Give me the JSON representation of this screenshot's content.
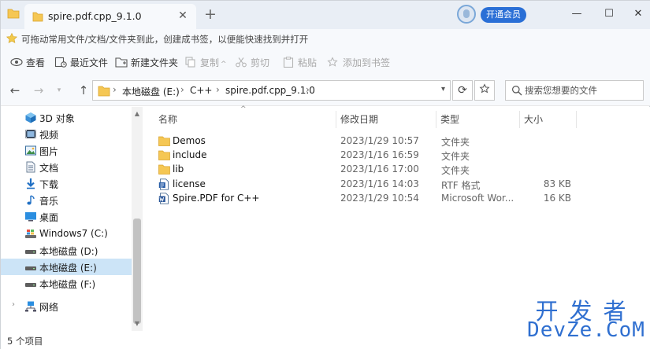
{
  "tab": {
    "title": "spire.pdf.cpp_9.1.0",
    "close": "✕",
    "new_tab": "+"
  },
  "header": {
    "vip_label": "开通会员",
    "minimize": "—",
    "maximize": "☐",
    "close": "✕"
  },
  "bookmark_bar": {
    "text": "可拖动常用文件/文档/文件夹到此，创建成书签，以便能快速找到并打开"
  },
  "toolbar": {
    "view": "查看",
    "recent": "最近文件",
    "new_folder": "新建文件夹",
    "copy": "复制",
    "cut": "剪切",
    "paste": "粘贴",
    "add_bookmark": "添加到书签"
  },
  "nav": {
    "back": "←",
    "forward": "→",
    "up": "↑",
    "breadcrumb": [
      "本地磁盘 (E:)",
      "C++",
      "spire.pdf.cpp_9.1.0"
    ],
    "separator": "›",
    "refresh": "⟳",
    "search_placeholder": "搜索您想要的文件"
  },
  "sidebar": {
    "items": [
      {
        "label": "3D 对象",
        "icon": "3d-objects-icon"
      },
      {
        "label": "视频",
        "icon": "video-icon"
      },
      {
        "label": "图片",
        "icon": "pictures-icon"
      },
      {
        "label": "文档",
        "icon": "documents-icon"
      },
      {
        "label": "下载",
        "icon": "downloads-icon"
      },
      {
        "label": "音乐",
        "icon": "music-icon"
      },
      {
        "label": "桌面",
        "icon": "desktop-icon"
      },
      {
        "label": "Windows7 (C:)",
        "icon": "drive-icon"
      },
      {
        "label": "本地磁盘 (D:)",
        "icon": "drive-icon"
      },
      {
        "label": "本地磁盘 (E:)",
        "icon": "drive-icon",
        "selected": true
      },
      {
        "label": "本地磁盘 (F:)",
        "icon": "drive-icon"
      },
      {
        "label": "网络",
        "icon": "network-icon"
      }
    ]
  },
  "columns": {
    "name": "名称",
    "modified": "修改日期",
    "type": "类型",
    "size": "大小"
  },
  "files": [
    {
      "name": "Demos",
      "modified": "2023/1/29 10:57",
      "type": "文件夹",
      "size": "",
      "icon": "folder-icon"
    },
    {
      "name": "include",
      "modified": "2023/1/16 16:59",
      "type": "文件夹",
      "size": "",
      "icon": "folder-icon"
    },
    {
      "name": "lib",
      "modified": "2023/1/16 17:00",
      "type": "文件夹",
      "size": "",
      "icon": "folder-icon"
    },
    {
      "name": "license",
      "modified": "2023/1/16 14:03",
      "type": "RTF 格式",
      "size": "83 KB",
      "icon": "rtf-file-icon"
    },
    {
      "name": "Spire.PDF for C++",
      "modified": "2023/1/29 10:54",
      "type": "Microsoft Wor...",
      "size": "16 KB",
      "icon": "word-file-icon"
    }
  ],
  "status": {
    "count": "5 个项目"
  },
  "watermark": {
    "cn": "开发者",
    "en": "DevZe.CoM"
  },
  "colors": {
    "accent": "#2a6fd6",
    "selected": "#cce4f7",
    "folder": "#f5c754",
    "watermark": "#2f6fd0"
  }
}
